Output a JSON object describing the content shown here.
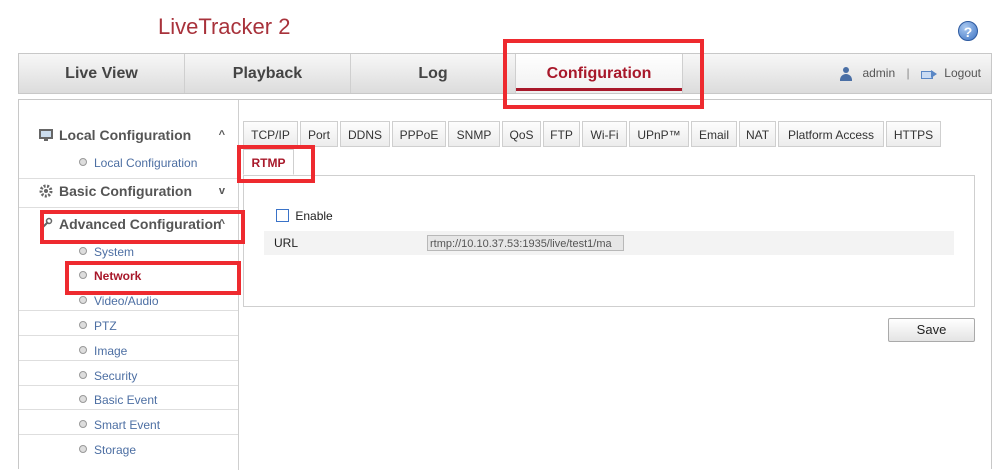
{
  "app": {
    "title": "LiveTracker 2",
    "help_icon": "help-icon"
  },
  "topnav": {
    "tabs": [
      {
        "label": "Live View"
      },
      {
        "label": "Playback"
      },
      {
        "label": "Log"
      },
      {
        "label": "Configuration",
        "active": true
      }
    ],
    "user": "admin",
    "separator": "|",
    "logout": "Logout"
  },
  "sidebar": {
    "local": {
      "label": "Local Configuration",
      "chevron": "^",
      "items": [
        {
          "label": "Local Configuration"
        }
      ]
    },
    "basic": {
      "label": "Basic Configuration",
      "chevron": "v"
    },
    "advanced": {
      "label": "Advanced Configuration",
      "chevron": "^",
      "items": [
        {
          "label": "System"
        },
        {
          "label": "Network",
          "active": true
        },
        {
          "label": "Video/Audio"
        },
        {
          "label": "PTZ"
        },
        {
          "label": "Image"
        },
        {
          "label": "Security"
        },
        {
          "label": "Basic Event"
        },
        {
          "label": "Smart Event"
        },
        {
          "label": "Storage"
        }
      ]
    }
  },
  "subtabs": [
    "TCP/IP",
    "Port",
    "DDNS",
    "PPPoE",
    "SNMP",
    "QoS",
    "FTP",
    "Wi-Fi",
    "UPnP™",
    "Email",
    "NAT",
    "Platform Access",
    "HTTPS",
    "RTMP"
  ],
  "active_subtab": "RTMP",
  "form": {
    "enable_label": "Enable",
    "enable_checked": false,
    "url_label": "URL",
    "url_value": "rtmp://10.10.37.53:1935/live/test1/ma"
  },
  "save_label": "Save",
  "colors": {
    "accent": "#a8182a",
    "highlight": "#ee2a2f",
    "link": "#4d6fa3"
  }
}
